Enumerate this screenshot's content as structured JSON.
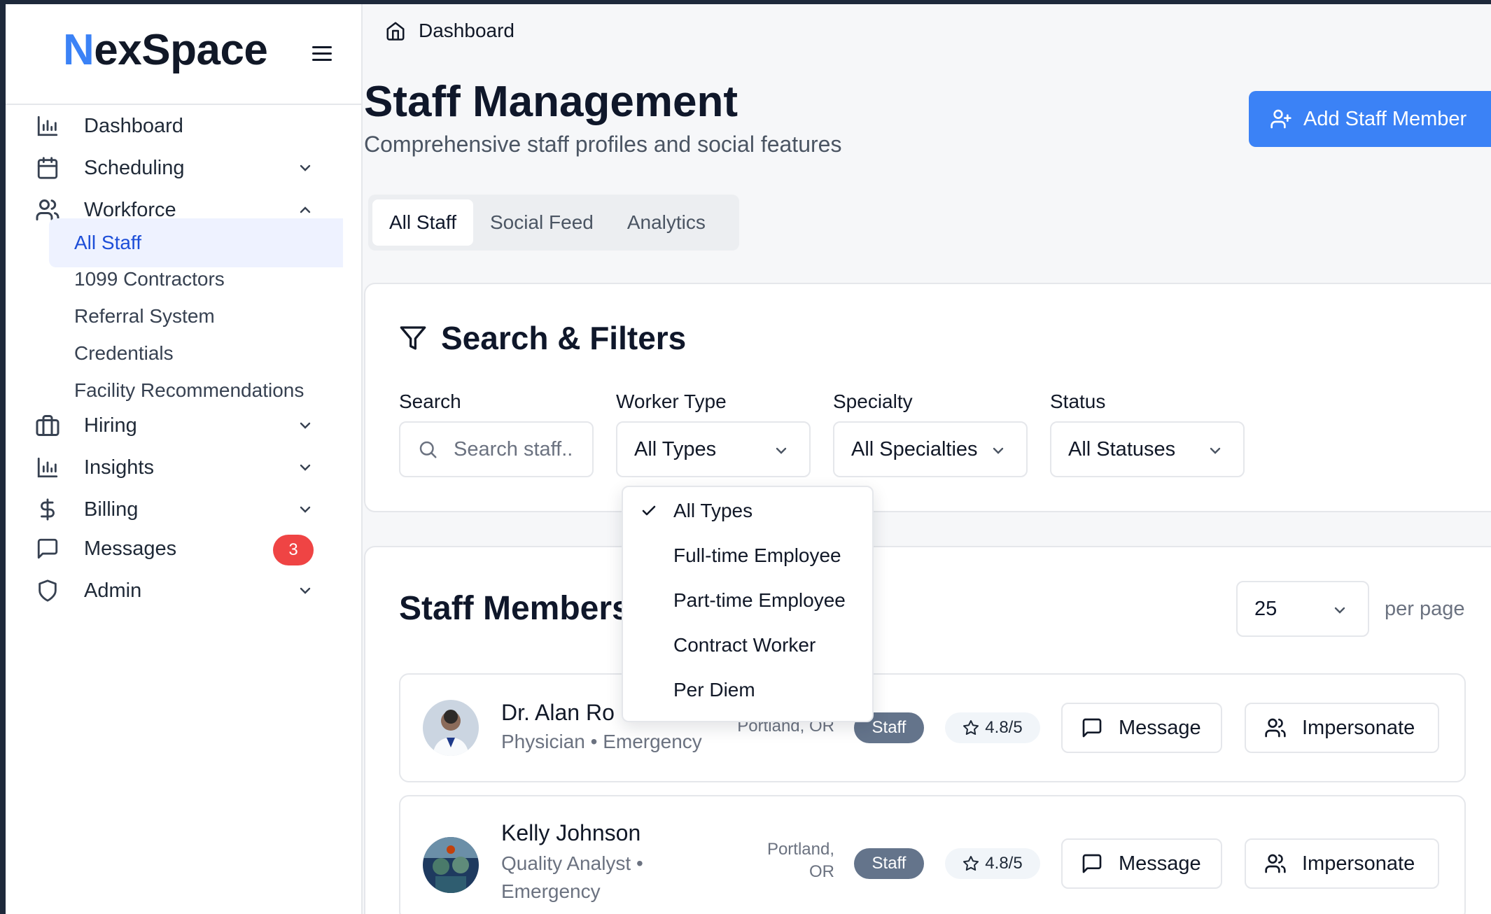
{
  "brand": {
    "first_letter": "N",
    "rest": "exSpace"
  },
  "sidebar": {
    "items": [
      {
        "label": "Dashboard",
        "icon": "bar-chart-icon"
      },
      {
        "label": "Scheduling",
        "icon": "calendar-icon"
      },
      {
        "label": "Workforce",
        "icon": "users-icon"
      },
      {
        "label": "Hiring",
        "icon": "briefcase-icon"
      },
      {
        "label": "Insights",
        "icon": "bar-chart-icon"
      },
      {
        "label": "Billing",
        "icon": "dollar-icon"
      },
      {
        "label": "Messages",
        "icon": "message-icon",
        "badge": "3"
      },
      {
        "label": "Admin",
        "icon": "shield-icon"
      }
    ],
    "workforce_sub": [
      "All Staff",
      "1099 Contractors",
      "Referral System",
      "Credentials",
      "Facility Recommendations"
    ]
  },
  "breadcrumb": {
    "label": "Dashboard"
  },
  "header": {
    "title": "Staff Management",
    "subtitle": "Comprehensive staff profiles and social features",
    "add_button": "Add Staff Member"
  },
  "tabs": [
    "All Staff",
    "Social Feed",
    "Analytics"
  ],
  "filters": {
    "title": "Search & Filters",
    "search_label": "Search",
    "search_placeholder": "Search staff..",
    "worker_type_label": "Worker Type",
    "worker_type_value": "All Types",
    "specialty_label": "Specialty",
    "specialty_value": "All Specialties",
    "status_label": "Status",
    "status_value": "All Statuses"
  },
  "worker_type_options": [
    "All Types",
    "Full-time Employee",
    "Part-time Employee",
    "Contract Worker",
    "Per Diem"
  ],
  "staff": {
    "title": "Staff Members",
    "per_page_value": "25",
    "per_page_label": "per page",
    "members": [
      {
        "name": "Dr. Alan Ro",
        "role_line1": "Physician • Emergency",
        "role_line2": "",
        "location_line1": "Portland, OR",
        "location_line2": "",
        "tag": "Staff",
        "rating": "4.8/5",
        "message": "Message",
        "impersonate": "Impersonate"
      },
      {
        "name": "Kelly Johnson",
        "role_line1": "Quality Analyst •",
        "role_line2": "Emergency",
        "location_line1": "Portland,",
        "location_line2": "OR",
        "tag": "Staff",
        "rating": "4.8/5",
        "message": "Message",
        "impersonate": "Impersonate"
      }
    ]
  },
  "colors": {
    "accent": "#3b82f6",
    "badge": "#ef4444",
    "tag": "#64748b"
  }
}
